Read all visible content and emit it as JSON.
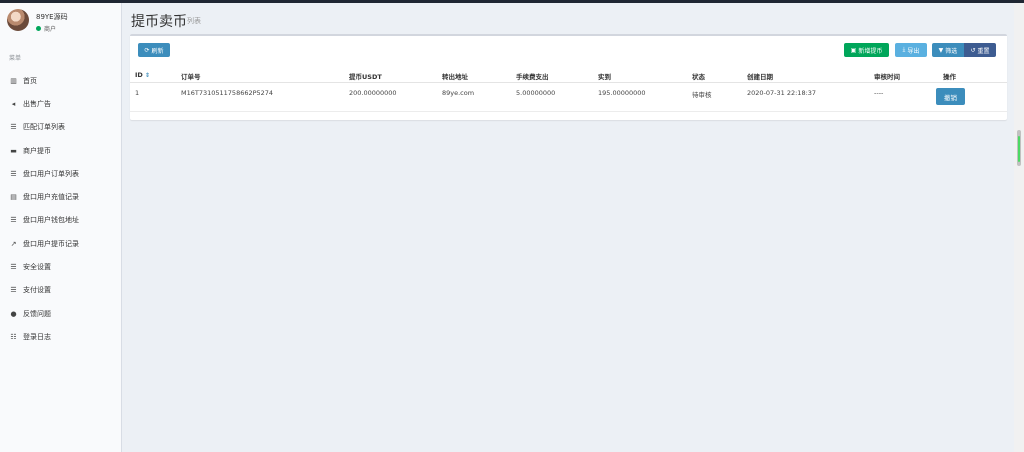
{
  "user": {
    "name": "89YE源码",
    "role": "商户"
  },
  "sidebar": {
    "header": "菜单",
    "items": [
      {
        "label": "首页",
        "icon": "chart-icon",
        "glyph": "▥"
      },
      {
        "label": "出售广告",
        "icon": "bullhorn-icon",
        "glyph": "◂"
      },
      {
        "label": "匹配订单列表",
        "icon": "list-icon",
        "glyph": "☰"
      },
      {
        "label": "商户提币",
        "icon": "credit-card-icon",
        "glyph": "▬"
      },
      {
        "label": "盘口用户订单列表",
        "icon": "list-icon",
        "glyph": "☰"
      },
      {
        "label": "盘口用户充值记录",
        "icon": "clipboard-icon",
        "glyph": "▤"
      },
      {
        "label": "盘口用户钱包地址",
        "icon": "list-icon",
        "glyph": "☰"
      },
      {
        "label": "盘口用户提币记录",
        "icon": "external-link-icon",
        "glyph": "↗"
      },
      {
        "label": "安全设置",
        "icon": "list-icon",
        "glyph": "☰"
      },
      {
        "label": "支付设置",
        "icon": "list-icon",
        "glyph": "☰"
      },
      {
        "label": "反馈问题",
        "icon": "comment-icon",
        "glyph": "●"
      },
      {
        "label": "登录日志",
        "icon": "list-ul-icon",
        "glyph": "☷"
      }
    ]
  },
  "page": {
    "title": "提币卖币",
    "subtitle": "列表"
  },
  "toolbar": {
    "refresh": "刷新",
    "add": "新增提币",
    "export": "导出",
    "filter": "筛选",
    "reset": "重置"
  },
  "table": {
    "columns": [
      "ID",
      "订单号",
      "提币USDT",
      "转出地址",
      "手续费支出",
      "实到",
      "状态",
      "创建日期",
      "审核时间",
      "操作"
    ],
    "rows": [
      {
        "id": "1",
        "order_no": "M16T7310511758662P5274",
        "usdt": "200.00000000",
        "address": "89ye.com",
        "fee": "5.00000000",
        "actual": "195.00000000",
        "status": "待审核",
        "created": "2020-07-31 22:18:37",
        "reviewed": "----",
        "action": "撤销"
      }
    ]
  }
}
